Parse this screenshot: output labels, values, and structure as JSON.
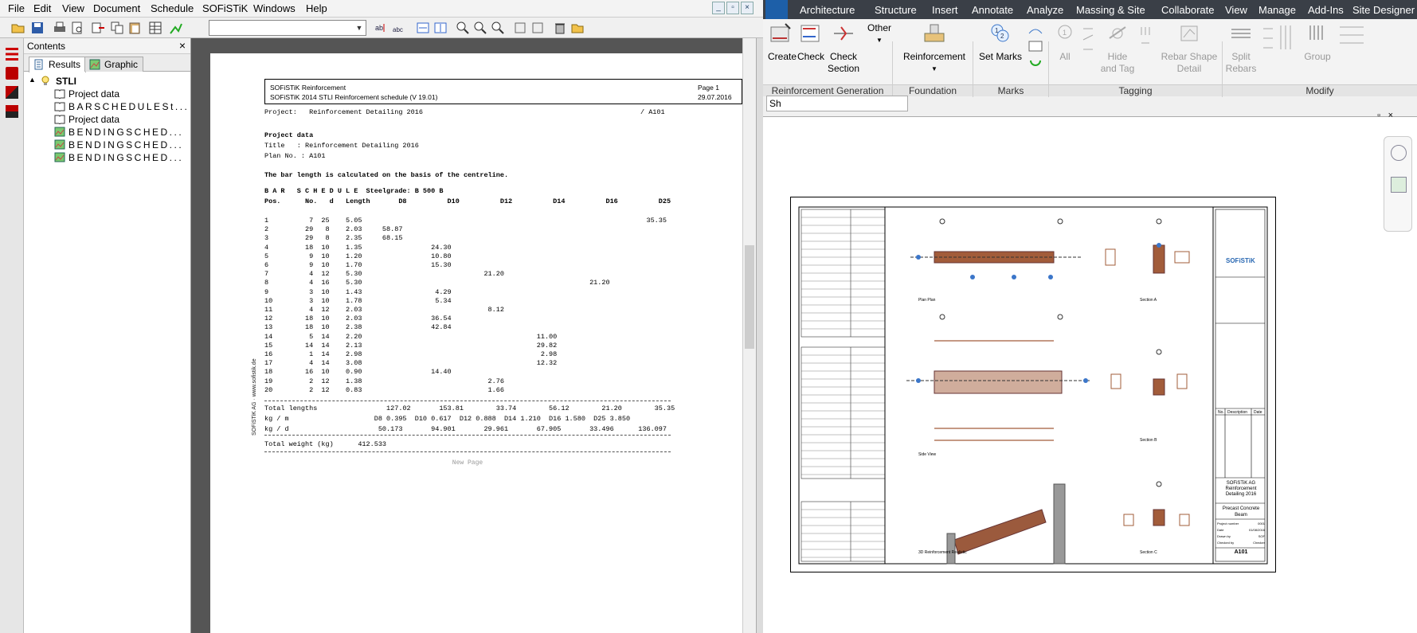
{
  "left_app": {
    "menu": [
      "File",
      "Edit",
      "View",
      "Document",
      "Schedule",
      "SOFiSTiK",
      "Windows",
      "Help"
    ],
    "window_controls": [
      "_",
      "▫",
      "×"
    ],
    "contents_panel": {
      "title": "Contents",
      "close": "×",
      "tabs": [
        "Results",
        "Graphic"
      ],
      "tree": [
        {
          "label": "STLI",
          "level": 0,
          "icon": "bulb-icon"
        },
        {
          "label": "Project data",
          "level": 1,
          "icon": "book-icon"
        },
        {
          "label": "BARSCHEDULESt...",
          "level": 1,
          "icon": "book-icon",
          "spaced": true
        },
        {
          "label": "Project data",
          "level": 1,
          "icon": "book-icon"
        },
        {
          "label": "BENDINGSCHED...",
          "level": 1,
          "icon": "image-icon",
          "spaced": true
        },
        {
          "label": "BENDINGSCHED...",
          "level": 1,
          "icon": "image-icon",
          "spaced": true
        },
        {
          "label": "BENDINGSCHED...",
          "level": 1,
          "icon": "image-icon",
          "spaced": true
        }
      ]
    },
    "report": {
      "header_left1": "SOFiSTiK Reinforcement",
      "header_left2": "SOFiSTiK 2014  STLI Reinforcement schedule  (V 19.01)",
      "header_right1": "Page  1",
      "header_right2": "29.07.2016",
      "project_line": "Project:   Reinforcement Detailing 2016",
      "sheet_ref": "/ A101",
      "project_data_title": "Project data",
      "title_line": "Title   : Reinforcement Detailing 2016",
      "plan_line": "Plan No. : A101",
      "note": "The bar length is calculated on the basis of the centreline.",
      "schedule_title": "B A R   S C H E D U L E  Steelgrade: B 500 B",
      "columns": "Pos.      No.   d   Length       D8          D10          D12          D14          D16          D25",
      "rows": [
        "1          7  25    5.05                                                                      35.35",
        "2         29   8    2.03     58.87",
        "3         29   8    2.35     68.15",
        "4         18  10    1.35                 24.30",
        "5          9  10    1.20                 10.80",
        "6          9  10    1.70                 15.30",
        "7          4  12    5.30                              21.20",
        "8          4  16    5.30                                                        21.20",
        "9          3  10    1.43                  4.29",
        "10         3  10    1.78                  5.34",
        "11         4  12    2.03                               8.12",
        "12        18  10    2.03                 36.54",
        "13        18  10    2.38                 42.84",
        "14         5  14    2.20                                           11.00",
        "15        14  14    2.13                                           29.82",
        "16         1  14    2.98                                            2.98",
        "17         4  14    3.08                                           12.32",
        "18        16  10    0.90                 14.40",
        "19         2  12    1.38                               2.76",
        "20         2  12    0.83                               1.66"
      ],
      "totals_line": "Total lengths                 127.02       153.81        33.74        56.12        21.20        35.35",
      "kgm_line": "kg / m                     D8 0.395  D10 0.617  D12 0.888  D14 1.210  D16 1.580  D25 3.850",
      "kgd_line": "kg / d                      50.173       94.901       29.961       67.905       33.496      136.097",
      "weight_line": "Total weight (kg)      412.533",
      "new_page": "New Page",
      "side_text": "SOFiSTiK AG · www.sofistik.de"
    }
  },
  "right_app": {
    "tabs": [
      "Architecture",
      "Structure",
      "Insert",
      "Annotate",
      "Analyze",
      "Massing & Site",
      "Collaborate",
      "View",
      "Manage",
      "Add-Ins",
      "Site Designer"
    ],
    "buttons": {
      "create": "Create",
      "check": "Check",
      "check_section1": "Check",
      "check_section2": "Section",
      "other": "Other",
      "reinforcement": "Reinforcement",
      "set_marks": "Set Marks",
      "all": "All",
      "hide1": "Hide",
      "hide2": "and Tag",
      "rebar1": "Rebar Shape",
      "rebar2": "Detail",
      "split1": "Split",
      "split2": "Rebars",
      "group": "Group"
    },
    "panels": [
      "Reinforcement Generation",
      "Foundation",
      "Marks",
      "Tagging",
      "Modify"
    ],
    "combo_value": "Sh",
    "sheet": {
      "logo": "SOFiSTiK",
      "company1": "SOFiSTiK AG",
      "company2": "Reinforcement",
      "company3": "Detailing 2016",
      "drawing1": "Precast Concrete",
      "drawing2": "Beam",
      "sheet_no": "A101",
      "rev_headers": [
        "No.",
        "Description",
        "Date"
      ],
      "info_labels": [
        "Project number",
        "Date",
        "Drawn by",
        "Checked by"
      ],
      "info_values": [
        "0001",
        "01/08/2016",
        "SOF",
        "Checker"
      ],
      "view_labels": [
        "Plan Plan",
        "Section A",
        "Side View",
        "Section B",
        "3D Reinforcement Realistic",
        "Section C"
      ]
    }
  }
}
